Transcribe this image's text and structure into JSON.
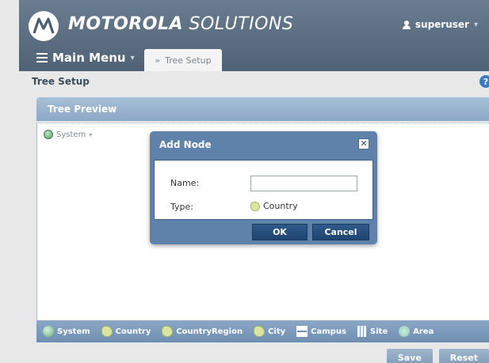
{
  "header": {
    "brand_bold": "MOTOROLA",
    "brand_light": "SOLUTIONS",
    "user": "superuser",
    "main_menu": "Main Menu",
    "tab_label": "Tree Setup"
  },
  "page": {
    "title": "Tree Setup",
    "help": "?"
  },
  "tree_preview": {
    "title": "Tree Preview",
    "root_node": "System"
  },
  "palette": [
    {
      "label": "System",
      "icon": "globe-icon"
    },
    {
      "label": "Country",
      "icon": "country-icon"
    },
    {
      "label": "CountryRegion",
      "icon": "country-region-icon"
    },
    {
      "label": "City",
      "icon": "city-icon"
    },
    {
      "label": "Campus",
      "icon": "campus-icon"
    },
    {
      "label": "Site",
      "icon": "site-icon"
    },
    {
      "label": "Area",
      "icon": "area-icon"
    }
  ],
  "actions": {
    "save": "Save",
    "reset": "Reset"
  },
  "dialog": {
    "title": "Add Node",
    "close": "✕",
    "name_label": "Name:",
    "name_value": "",
    "type_label": "Type:",
    "type_value": "Country",
    "ok": "OK",
    "cancel": "Cancel"
  },
  "colors": {
    "header_bg": "#5a6d82",
    "panel_head": "#9db6cf",
    "dialog_bg": "#5f82ab",
    "button_dark": "#2a5080"
  }
}
